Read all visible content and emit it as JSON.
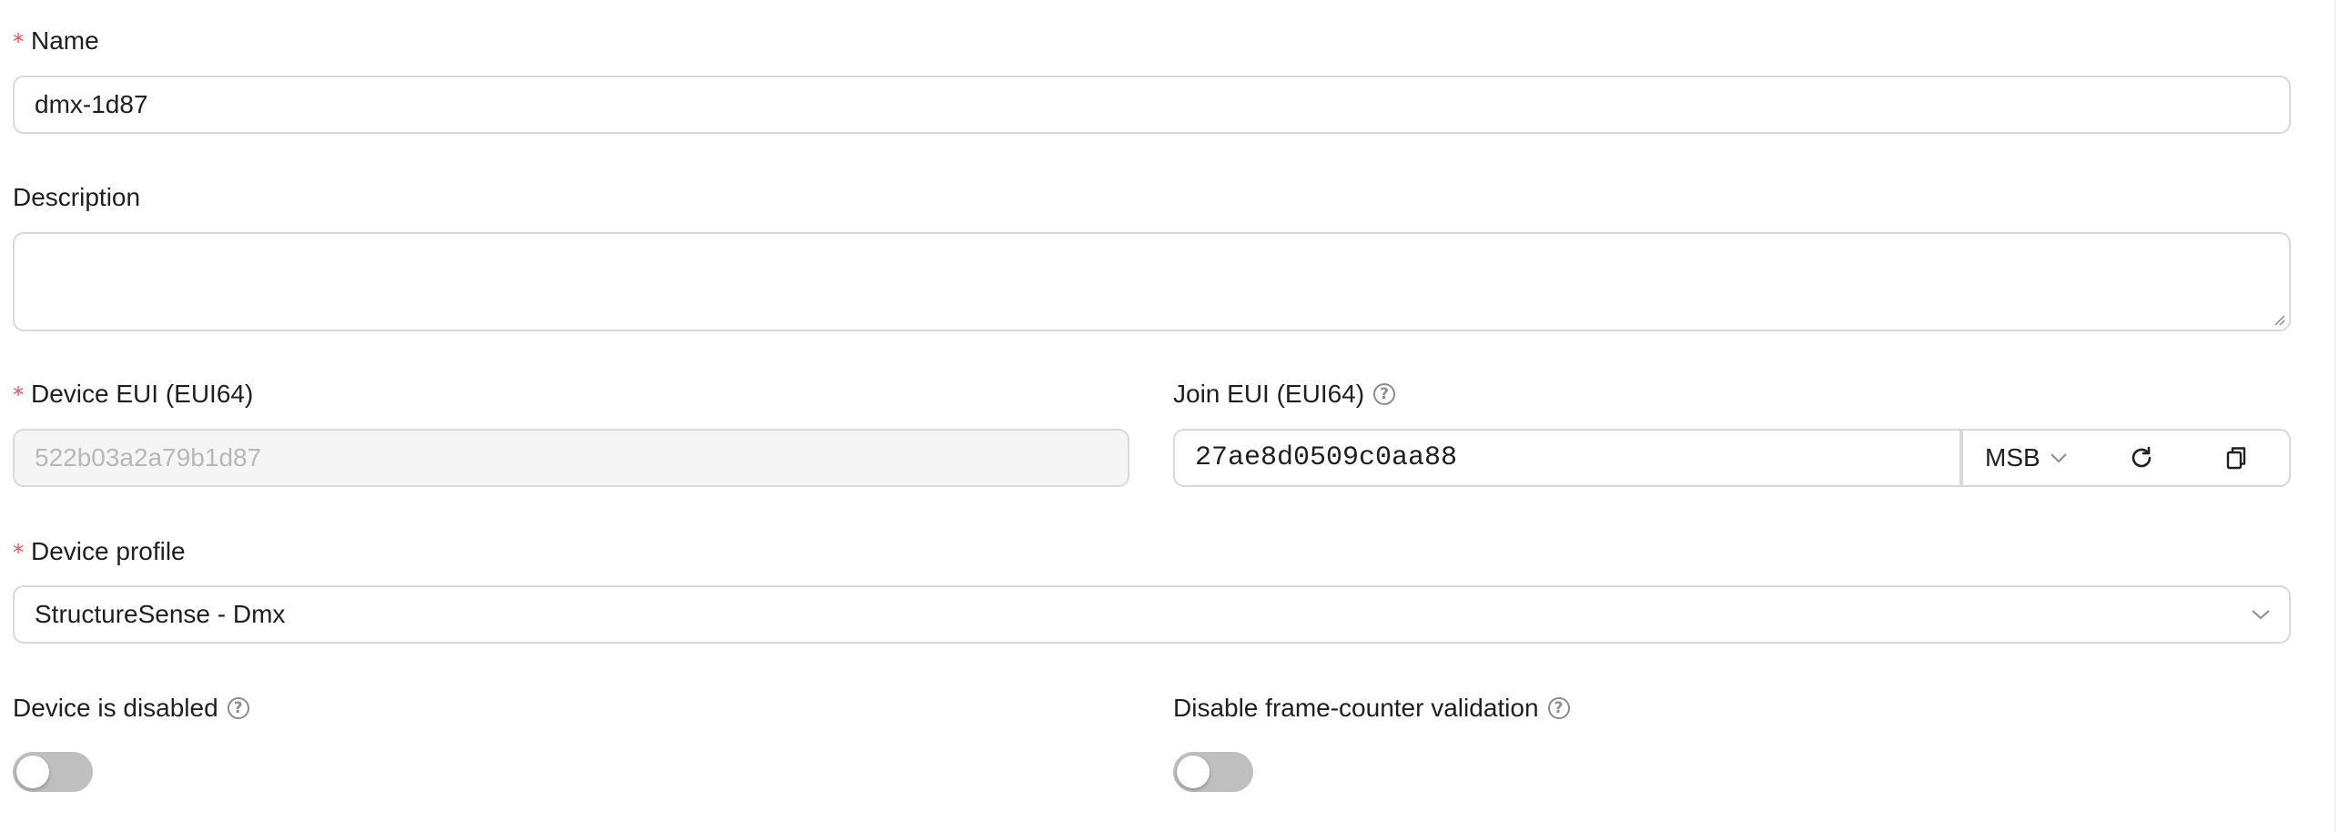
{
  "fields": {
    "name": {
      "label": "Name",
      "required": true,
      "value": "dmx-1d87"
    },
    "description": {
      "label": "Description",
      "value": ""
    },
    "dev_eui": {
      "label": "Device EUI (EUI64)",
      "required": true,
      "value": "522b03a2a79b1d87",
      "disabled": true
    },
    "join_eui": {
      "label": "Join EUI (EUI64)",
      "value": "27ae8d0509c0aa88",
      "byte_order": "MSB",
      "help_icon": "question-circle-icon",
      "refresh_icon": "refresh-icon",
      "copy_icon": "copy-icon"
    },
    "device_profile": {
      "label": "Device profile",
      "required": true,
      "value": "StructureSense - Dmx"
    },
    "device_disabled": {
      "label": "Device is disabled",
      "checked": false,
      "help_icon": "question-circle-icon"
    },
    "skip_fcnt_check": {
      "label": "Disable frame-counter validation",
      "checked": false,
      "help_icon": "question-circle-icon"
    }
  },
  "colors": {
    "required_marker": "#ff4d4f",
    "border": "#d9d9d9",
    "disabled_bg": "#f5f5f5",
    "switch_off": "#bfbfbf"
  }
}
